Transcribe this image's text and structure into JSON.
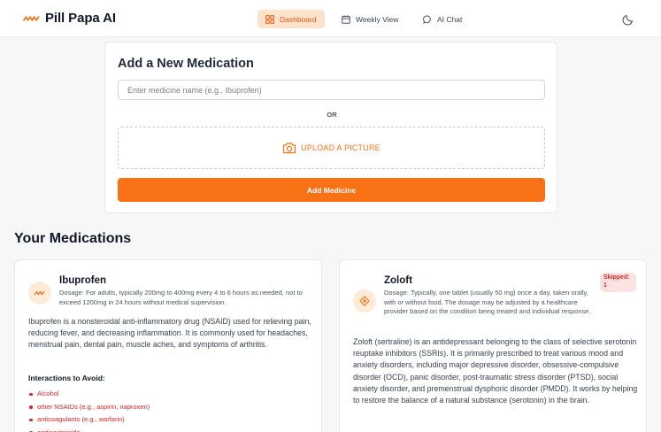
{
  "app": {
    "name": "Pill Papa AI",
    "colors": {
      "accent": "#f97316",
      "accent_soft": "#fde3cc",
      "danger": "#dc2626",
      "background": "#f7f7f8"
    }
  },
  "nav": {
    "items": [
      {
        "label": "Dashboard",
        "icon": "grid-icon",
        "active": true
      },
      {
        "label": "Weekly View",
        "icon": "calendar-icon",
        "active": false
      },
      {
        "label": "AI Chat",
        "icon": "chat-bubble-icon",
        "active": false
      }
    ],
    "theme_toggle_icon": "moon-icon"
  },
  "add_medication": {
    "title": "Add a New Medication",
    "input": {
      "placeholder": "Enter medicine name (e.g., Ibuprofen)",
      "value": ""
    },
    "or_label": "OR",
    "upload_label": "UPLOAD A PICTURE",
    "upload_icon": "camera-icon",
    "button_label": "Add Medicine"
  },
  "medications_section": {
    "title": "Your Medications",
    "items": [
      {
        "name": "Ibuprofen",
        "icon": "pill-wave-icon",
        "dosage": "Dosage: For adults, typically 200mg to 400mg every 4 to 6 hours as needed, not to exceed 1200mg in 24 hours without medical supervision.",
        "description": "Ibuprofen is a nonsteroidal anti-inflammatory drug (NSAID) used for relieving pain, reducing fever, and decreasing inflammation. It is commonly used for headaches, menstrual pain, dental pain, muscle aches, and symptoms of arthritis.",
        "interactions_title": "Interactions to Avoid:",
        "interactions": [
          "Alcohol",
          "other NSAIDs (e.g., aspirin, naproxen)",
          "anticoagulants (e.g., warfarin)",
          "corticosteroids"
        ]
      },
      {
        "name": "Zoloft",
        "icon": "pill-diamond-icon",
        "skipped_badge": "Skipped: 1",
        "dosage": "Dosage: Typically, one tablet (usually 50 mg) once a day, taken orally, with or without food. The dosage may be adjusted by a healthcare provider based on the condition being treated and individual response.",
        "description": "Zoloft (sertraline) is an antidepressant belonging to the class of selective serotonin reuptake inhibitors (SSRIs). It is primarily prescribed to treat various mood and anxiety disorders, including major depressive disorder, obsessive-compulsive disorder (OCD), panic disorder, post-traumatic stress disorder (PTSD), social anxiety disorder, and premenstrual dysphoric disorder (PMDD). It works by helping to restore the balance of a natural substance (serotonin) in the brain."
      }
    ]
  }
}
